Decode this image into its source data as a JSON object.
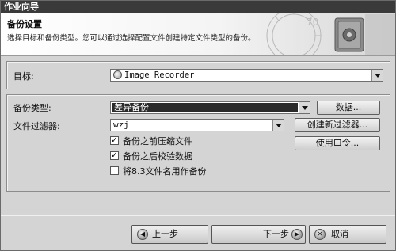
{
  "window": {
    "title": "作业向导"
  },
  "header": {
    "title": "备份设置",
    "description": "选择目标和备份类型。您可以通过选择配置文件创建特定文件类型的备份。"
  },
  "target": {
    "label": "目标:",
    "value": "Image Recorder",
    "icon": "disc-drive-icon"
  },
  "backup_type": {
    "label": "备份类型:",
    "value": "差异备份",
    "button": "数据..."
  },
  "file_filter": {
    "label": "文件过滤器:",
    "value": "wzj",
    "button": "创建新过滤器..."
  },
  "password_button": "使用口令...",
  "options": [
    {
      "label": "备份之前压缩文件",
      "checked": true
    },
    {
      "label": "备份之后校验数据",
      "checked": true
    },
    {
      "label": "将8.3文件名用作备份",
      "checked": false
    }
  ],
  "nav": {
    "back": "上一步",
    "next": "下一步",
    "cancel": "取消"
  },
  "colors": {
    "titlebar": "#3a3a3a",
    "dialog": "#d4d4d4",
    "selection": "#2a2a2a"
  }
}
